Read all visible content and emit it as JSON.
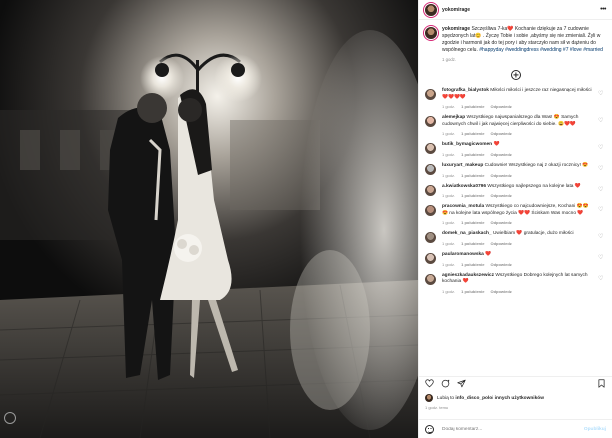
{
  "header": {
    "username": "yokomirage",
    "more_glyph": "•••"
  },
  "caption": {
    "username": "yokomirage",
    "text": " Szczęśliwa 7-ka❤️ Kochanie dziękuje za 7 cudownie spędzonych lat😊 . Życzę Tobie i sobie ,abyśmy się nie zmieniali. Żyli w zgodzie i harmonii jak do tej pory i aby starczyło nam sił w dążeniu do wspólnego celu. ",
    "hashtags": "#happyday #weddingdress #wedding #7 #love #married",
    "time": "1 godz."
  },
  "comments": [
    {
      "user": "fotografka_bialystok",
      "text": " Miłości miłości i jeszcze raz niegasnącej miłości ❤️❤️❤️❤️",
      "time": "1 godz.",
      "likes": "1 polubienie",
      "reply": "Odpowiedz"
    },
    {
      "user": "alemejkap",
      "text": " Wszystkiego najwspanialszego dla Was! 😍 Samych cudownych chwil i jak najwięcej cierpliwości do siebie. 😀❤️❤️",
      "time": "1 godz.",
      "likes": "1 polubienie",
      "reply": "Odpowiedz"
    },
    {
      "user": "butik_bymagicwomen",
      "text": " ❤️",
      "time": "1 godz.",
      "likes": "1 polubienie",
      "reply": "Odpowiedz"
    },
    {
      "user": "luxuryart_makeup",
      "text": " Cudownie! Wszystkiego naj z okazji rocznicy! 😍",
      "time": "1 godz.",
      "likes": "1 polubienie",
      "reply": "Odpowiedz"
    },
    {
      "user": "a.kwiatkowska0796",
      "text": " Wszystkiego najlepszego na kolejne lata ❤️",
      "time": "1 godz.",
      "likes": "1 polubienie",
      "reply": "Odpowiedz"
    },
    {
      "user": "pracownia_motula",
      "text": " Wszystkiego co najcudowniejsze, Kochani 😍😍😍 na kolejne lata wspólnego życia ❤️❤️ Ściskam Was mocno ❤️",
      "time": "1 godz.",
      "likes": "1 polubienie",
      "reply": "Odpowiedz"
    },
    {
      "user": "domek_na_piaskach_",
      "text": " Uwielbiam ❤️ gratulacje, dużo miłości",
      "time": "1 godz.",
      "likes": "1 polubienie",
      "reply": "Odpowiedz"
    },
    {
      "user": "paularomanowska",
      "text": " ❤️",
      "time": "1 godz.",
      "likes": "1 polubienie",
      "reply": "Odpowiedz"
    },
    {
      "user": "agnieszkadaukszewicz",
      "text": " Wszystkiego Dobrego kolejnych lat samych kochania ❤️",
      "time": "1 godz.",
      "likes": "1 polubienie",
      "reply": "Odpowiedz"
    }
  ],
  "likes": {
    "prefix": "Lubią to ",
    "user": "info_disco_polo",
    "middle": " i ",
    "others": "innych użytkowników"
  },
  "post_date": "1 godz. temu",
  "add_comment": {
    "placeholder": "Dodaj komentarz...",
    "publish_label": "Opublikuj"
  },
  "icons": {
    "heart": "heart-icon",
    "comment": "comment-icon",
    "share": "share-icon",
    "bookmark": "bookmark-icon",
    "load_more": "plus-circle-icon",
    "emoji": "emoji-icon"
  },
  "colors": {
    "link": "#00376b",
    "muted": "#8e8e8e",
    "publish": "#b2dffc",
    "heart_red": "#ed4956"
  }
}
